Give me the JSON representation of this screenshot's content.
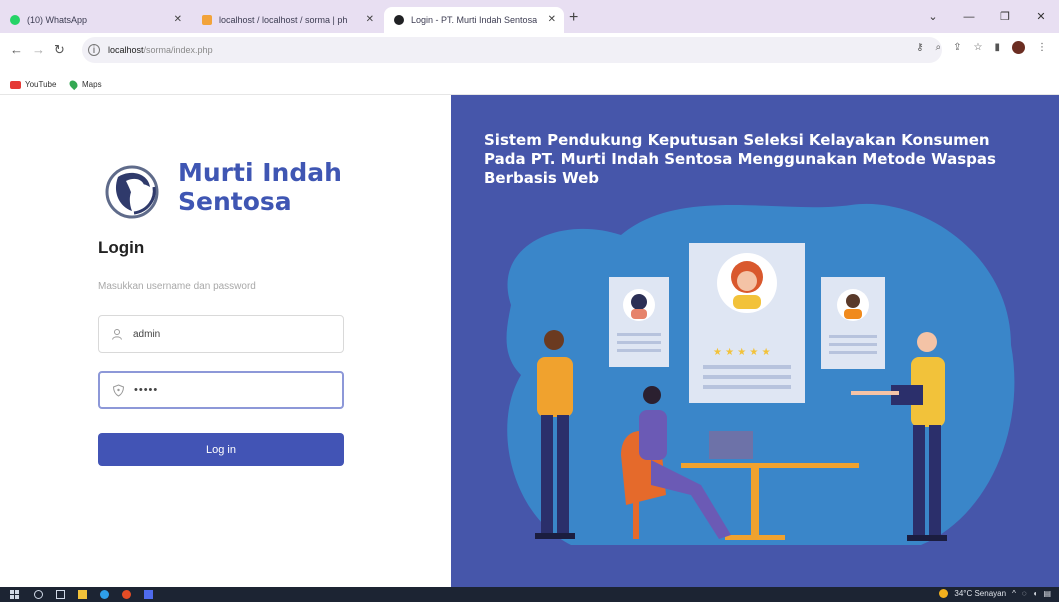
{
  "browser": {
    "tabs": [
      {
        "title": "(10) WhatsApp",
        "favicon_color": "#25d366"
      },
      {
        "title": "localhost / localhost / sorma | ph",
        "favicon_color": "#f2a33a"
      },
      {
        "title": "Login - PT. Murti Indah Sentosa",
        "favicon_color": "#202124"
      }
    ],
    "new_tab": "+",
    "url_host": "localhost",
    "url_path": "/sorma/index.php",
    "bookmarks": [
      "YouTube",
      "Maps"
    ]
  },
  "login": {
    "brand_line1": "Murti Indah",
    "brand_line2": "Sentosa",
    "title": "Login",
    "subtitle": "Masukkan username dan password",
    "username_value": "admin",
    "password_value": "•••••",
    "button_label": "Log in"
  },
  "hero": {
    "headline": "Sistem Pendukung Keputusan Seleksi Kelayakan Konsumen Pada PT. Murti Indah Sentosa Menggunakan Metode Waspas Berbasis Web"
  },
  "taskbar": {
    "weather": "34°C Senayan"
  },
  "colors": {
    "accent": "#4254b5",
    "hero_bg": "#4656aa",
    "brand": "#3f56b3"
  }
}
